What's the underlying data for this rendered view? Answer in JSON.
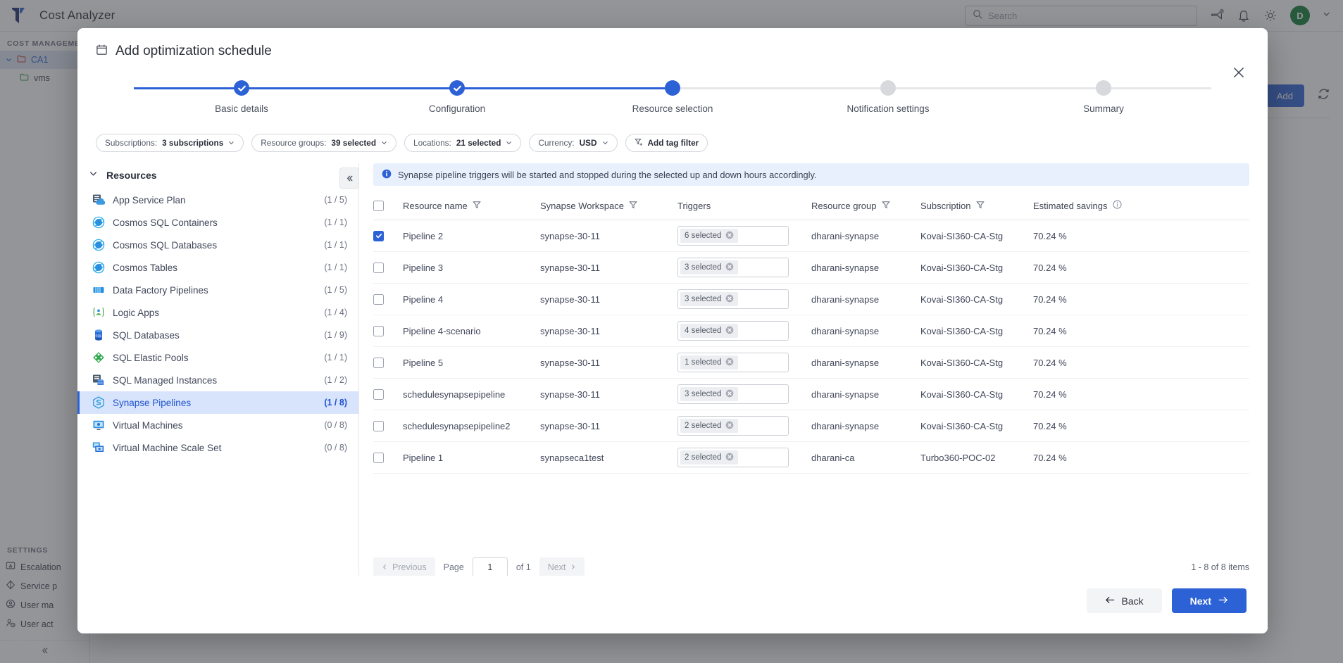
{
  "app": {
    "brand": "Cost Analyzer",
    "brand_color": "#1f3a93",
    "accent_color": "#2d62d6",
    "success_color": "#17a04a",
    "search": {
      "placeholder": "Search",
      "value": ""
    },
    "header_icons": [
      {
        "name": "announcement-icon"
      },
      {
        "name": "bell-icon"
      },
      {
        "name": "gear-icon"
      }
    ],
    "avatar_initial": "D"
  },
  "leftnav": {
    "section_label": "COST MANAGEMENT",
    "tree": [
      {
        "label": "CA1",
        "selected": true,
        "icon": "folder-icon",
        "folder_color": "#c0392b"
      },
      {
        "label": "vms",
        "selected": false,
        "icon": "folder-icon",
        "folder_color": "#2f9e44",
        "indent": true
      }
    ],
    "settings_label": "SETTINGS",
    "settings_items": [
      {
        "label": "Escalation",
        "icon": "escalation-icon"
      },
      {
        "label": "Service p",
        "icon": "diamond-icon"
      },
      {
        "label": "User ma",
        "icon": "user-circle-icon"
      },
      {
        "label": "User act",
        "icon": "user-clock-icon"
      }
    ],
    "collapse_icon": "chevron-double-left-icon"
  },
  "background": {
    "add_button": "Add",
    "refresh_icon": "refresh-icon"
  },
  "modal": {
    "title": "Add optimization schedule",
    "title_icon": "calendar-icon",
    "close_icon": "close-icon",
    "stepper": {
      "steps": [
        {
          "label": "Basic details",
          "state": "done"
        },
        {
          "label": "Configuration",
          "state": "done"
        },
        {
          "label": "Resource selection",
          "state": "current"
        },
        {
          "label": "Notification settings",
          "state": "pending"
        },
        {
          "label": "Summary",
          "state": "pending"
        }
      ]
    },
    "filters": [
      {
        "name": "subscriptions-filter",
        "prefix": "Subscriptions:",
        "value": "3 subscriptions",
        "has_chevron": true,
        "icon": null
      },
      {
        "name": "resource-groups-filter",
        "prefix": "Resource groups:",
        "value": "39 selected",
        "has_chevron": true,
        "icon": null
      },
      {
        "name": "locations-filter",
        "prefix": "Locations:",
        "value": "21 selected",
        "has_chevron": true,
        "icon": null
      },
      {
        "name": "currency-filter",
        "prefix": "Currency:",
        "value": "USD",
        "has_chevron": true,
        "icon": null
      },
      {
        "name": "add-tag-filter",
        "prefix": "",
        "value": "Add tag filter",
        "has_chevron": false,
        "icon": "filter-plus-icon"
      }
    ],
    "resources_panel": {
      "header": "Resources",
      "expand_icon": "chevron-down-icon",
      "collapse_icon": "chevron-double-left-icon",
      "items": [
        {
          "label": "App Service Plan",
          "count": "(1 / 5)",
          "icon": "app-service-plan-icon",
          "active": false
        },
        {
          "label": "Cosmos SQL Containers",
          "count": "(1 / 1)",
          "icon": "cosmos-db-icon",
          "active": false
        },
        {
          "label": "Cosmos SQL Databases",
          "count": "(1 / 1)",
          "icon": "cosmos-db-icon",
          "active": false
        },
        {
          "label": "Cosmos Tables",
          "count": "(1 / 1)",
          "icon": "cosmos-db-icon",
          "active": false
        },
        {
          "label": "Data Factory Pipelines",
          "count": "(1 / 5)",
          "icon": "data-factory-icon",
          "active": false
        },
        {
          "label": "Logic Apps",
          "count": "(1 / 4)",
          "icon": "logic-apps-icon",
          "active": false
        },
        {
          "label": "SQL Databases",
          "count": "(1 / 9)",
          "icon": "sql-database-icon",
          "active": false
        },
        {
          "label": "SQL Elastic Pools",
          "count": "(1 / 1)",
          "icon": "sql-elastic-pool-icon",
          "active": false
        },
        {
          "label": "SQL Managed Instances",
          "count": "(1 / 2)",
          "icon": "sql-managed-instance-icon",
          "active": false
        },
        {
          "label": "Synapse Pipelines",
          "count": "(1 / 8)",
          "icon": "synapse-icon",
          "active": true
        },
        {
          "label": "Virtual Machines",
          "count": "(0 / 8)",
          "icon": "virtual-machine-icon",
          "active": false
        },
        {
          "label": "Virtual Machine Scale Set",
          "count": "(0 / 8)",
          "icon": "vm-scale-set-icon",
          "active": false
        }
      ]
    },
    "info_banner": {
      "icon": "info-icon",
      "text": "Synapse pipeline triggers will be started and stopped during the selected up and down hours accordingly."
    },
    "table": {
      "columns": [
        {
          "label": "",
          "name": "select-all",
          "filter": false,
          "info": false
        },
        {
          "label": "Resource name",
          "name": "resource-name",
          "filter": true,
          "info": false
        },
        {
          "label": "Synapse Workspace",
          "name": "synapse-workspace",
          "filter": true,
          "info": false
        },
        {
          "label": "Triggers",
          "name": "triggers",
          "filter": false,
          "info": false
        },
        {
          "label": "Resource group",
          "name": "resource-group",
          "filter": true,
          "info": false
        },
        {
          "label": "Subscription",
          "name": "subscription",
          "filter": true,
          "info": false
        },
        {
          "label": "Estimated savings",
          "name": "estimated-savings",
          "filter": false,
          "info": true
        }
      ],
      "rows": [
        {
          "selected": true,
          "resource_name": "Pipeline 2",
          "workspace": "synapse-30-11",
          "triggers": "6 selected",
          "resource_group": "dharani-synapse",
          "subscription": "Kovai-SI360-CA-Stg",
          "savings": "70.24 %"
        },
        {
          "selected": false,
          "resource_name": "Pipeline 3",
          "workspace": "synapse-30-11",
          "triggers": "3 selected",
          "resource_group": "dharani-synapse",
          "subscription": "Kovai-SI360-CA-Stg",
          "savings": "70.24 %"
        },
        {
          "selected": false,
          "resource_name": "Pipeline 4",
          "workspace": "synapse-30-11",
          "triggers": "3 selected",
          "resource_group": "dharani-synapse",
          "subscription": "Kovai-SI360-CA-Stg",
          "savings": "70.24 %"
        },
        {
          "selected": false,
          "resource_name": "Pipeline 4-scenario",
          "workspace": "synapse-30-11",
          "triggers": "4 selected",
          "resource_group": "dharani-synapse",
          "subscription": "Kovai-SI360-CA-Stg",
          "savings": "70.24 %"
        },
        {
          "selected": false,
          "resource_name": "Pipeline 5",
          "workspace": "synapse-30-11",
          "triggers": "1 selected",
          "resource_group": "dharani-synapse",
          "subscription": "Kovai-SI360-CA-Stg",
          "savings": "70.24 %"
        },
        {
          "selected": false,
          "resource_name": "schedulesynapsepipeline",
          "workspace": "synapse-30-11",
          "triggers": "3 selected",
          "resource_group": "dharani-synapse",
          "subscription": "Kovai-SI360-CA-Stg",
          "savings": "70.24 %"
        },
        {
          "selected": false,
          "resource_name": "schedulesynapsepipeline2",
          "workspace": "synapse-30-11",
          "triggers": "2 selected",
          "resource_group": "dharani-synapse",
          "subscription": "Kovai-SI360-CA-Stg",
          "savings": "70.24 %"
        },
        {
          "selected": false,
          "resource_name": "Pipeline 1",
          "workspace": "synapseca1test",
          "triggers": "2 selected",
          "resource_group": "dharani-ca",
          "subscription": "Turbo360-POC-02",
          "savings": "70.24 %"
        }
      ]
    },
    "pagination": {
      "previous": "Previous",
      "page_label": "Page",
      "page_value": "1",
      "of_label": "of 1",
      "next": "Next",
      "summary": "1 - 8 of 8 items"
    },
    "footer": {
      "back": "Back",
      "next": "Next"
    }
  }
}
